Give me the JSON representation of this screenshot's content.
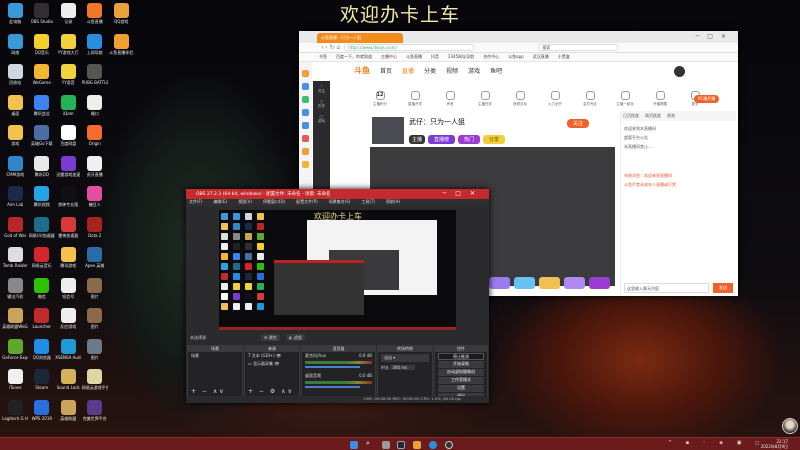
{
  "wallpaper_text": "欢迎办卡上车",
  "desktop_icons": [
    {
      "label": "此电脑",
      "icon": "computer-icon",
      "color": "#3a9ad9"
    },
    {
      "label": "网络",
      "icon": "network-icon",
      "color": "#3a9ad9"
    },
    {
      "label": "回收站",
      "icon": "recycle-bin-icon",
      "color": "#cfd8e0"
    },
    {
      "label": "桌面",
      "icon": "folder-icon",
      "color": "#f2c14e"
    },
    {
      "label": "游戏",
      "icon": "folder-icon",
      "color": "#f2c14e"
    },
    {
      "label": "CMM游戏",
      "icon": "app-icon",
      "color": "#2f86c9"
    },
    {
      "label": "Aim Lab",
      "icon": "aimlab-icon",
      "color": "#1b2a4a"
    },
    {
      "label": "God of War",
      "icon": "godofwar-icon",
      "color": "#b8262a"
    },
    {
      "label": "Tomb Raider",
      "icon": "tombraider-icon",
      "color": "#dddddd"
    },
    {
      "label": "输出汽机",
      "icon": "app-icon",
      "color": "#888888"
    },
    {
      "label": "英雄联盟WeGame",
      "icon": "lol-icon",
      "color": "#c9a55a"
    },
    {
      "label": "GeForce Experience",
      "icon": "nvidia-icon",
      "color": "#5fa82a"
    },
    {
      "label": "iTunes",
      "icon": "itunes-icon",
      "color": "#f0f0f0"
    },
    {
      "label": "Logitech G HUB",
      "icon": "logitech-icon",
      "color": "#222222"
    },
    {
      "label": "OBS Studio",
      "icon": "obs-icon",
      "color": "#302e31"
    },
    {
      "label": "QQ音乐",
      "icon": "qqmusic-icon",
      "color": "#f2cf2a"
    },
    {
      "label": "WeGame",
      "icon": "wegame-icon",
      "color": "#f2b632"
    },
    {
      "label": "腾讯会议",
      "icon": "app-icon",
      "color": "#3c82f0"
    },
    {
      "label": "英雄Go下载",
      "icon": "app-icon",
      "color": "#4a6fa5"
    },
    {
      "label": "腾讯QQ",
      "icon": "qq-icon",
      "color": "#e8e8e8"
    },
    {
      "label": "腾讯视频",
      "icon": "tencent-video-icon",
      "color": "#27a4e6"
    },
    {
      "label": "网易UU加速器",
      "icon": "uu-icon",
      "color": "#1c6e8c"
    },
    {
      "label": "网易云音乐",
      "icon": "netease-music-icon",
      "color": "#d4262c"
    },
    {
      "label": "微信",
      "icon": "wechat-icon",
      "color": "#2dc100"
    },
    {
      "label": "Launcher",
      "icon": "launcher-icon",
      "color": "#c02a2a"
    },
    {
      "label": "QQ浏览器",
      "icon": "qq-browser-icon",
      "color": "#1f8fe6"
    },
    {
      "label": "Steam",
      "icon": "steam-icon",
      "color": "#1b2838"
    },
    {
      "label": "WPS 2019",
      "icon": "wps-icon",
      "color": "#2b6fde"
    },
    {
      "label": "记录",
      "icon": "document-icon",
      "color": "#eeeeee"
    },
    {
      "label": "YY游戏大厅",
      "icon": "yy-icon",
      "color": "#f2d23c"
    },
    {
      "label": "YY语音",
      "icon": "yy-voice-icon",
      "color": "#f2d23c"
    },
    {
      "label": "iQom",
      "icon": "app-icon",
      "color": "#22b456"
    },
    {
      "label": "百度网盘",
      "icon": "baidu-pan-icon",
      "color": "#ffffff"
    },
    {
      "label": "迅雷游戏加速",
      "icon": "game-icon",
      "color": "#7a3bd1"
    },
    {
      "label": "剪映专业版",
      "icon": "capcut-icon",
      "color": "#111111"
    },
    {
      "label": "雷神加速器",
      "icon": "app-icon",
      "color": "#d63a3a"
    },
    {
      "label": "腾讯游戏",
      "icon": "folder-icon",
      "color": "#f2c14e"
    },
    {
      "label": "短信号",
      "icon": "document-icon",
      "color": "#eeeeee"
    },
    {
      "label": "反应游戏",
      "icon": "document-icon",
      "color": "#eeeeee"
    },
    {
      "label": "XSENSA Audio",
      "icon": "audio-icon",
      "color": "#1e9ad6"
    },
    {
      "label": "Sound Lock",
      "icon": "lock-icon",
      "color": "#d4b25a"
    },
    {
      "label": "英雄联盟",
      "icon": "lol-icon",
      "color": "#c9a55a"
    },
    {
      "label": "斗鱼直播",
      "icon": "douyu-icon",
      "color": "#f0772a"
    },
    {
      "label": "上网导航",
      "icon": "ie-icon",
      "color": "#2a8ee0"
    },
    {
      "label": "PUBG BATTLEGROUNDS",
      "icon": "pubg-icon",
      "color": "#555555"
    },
    {
      "label": "端口",
      "icon": "document-icon",
      "color": "#eeeeee"
    },
    {
      "label": "Origin",
      "icon": "origin-icon",
      "color": "#f56c2d"
    },
    {
      "label": "虎牙直播",
      "icon": "huya-icon",
      "color": "#f0f0f0"
    },
    {
      "label": "糖豆人",
      "icon": "fallguys-icon",
      "color": "#e24fa0"
    },
    {
      "label": "Dota 2",
      "icon": "dota-icon",
      "color": "#a8231c"
    },
    {
      "label": "Apex 英雄",
      "icon": "apex-icon",
      "color": "#2a6ca8"
    },
    {
      "label": "图片",
      "icon": "image-icon",
      "color": "#8a6a4a"
    },
    {
      "label": "图片",
      "icon": "image-icon",
      "color": "#8a6a4a"
    },
    {
      "label": "图片",
      "icon": "image-icon",
      "color": "#6a7a8a"
    },
    {
      "label": "网易云游戏平台",
      "icon": "app-icon",
      "color": "#ddd6a0"
    },
    {
      "label": "完美世界平台",
      "icon": "app-icon",
      "color": "#5a3d8a"
    },
    {
      "label": "QQ游戏",
      "icon": "qq-game-icon",
      "color": "#e8a23a"
    },
    {
      "label": "斗鱼直播伴侣",
      "icon": "app-icon",
      "color": "#f0a030"
    }
  ],
  "browser": {
    "tab_label": "斗鱼直播 - 只为一人狙",
    "url": "https://www.douyu.com/",
    "search": "搜索",
    "bookmarks": [
      "书签",
      "百度一下，你就知道",
      "主播中心",
      "斗鱼直播",
      "抖音",
      "2345网址导航",
      "合作中心",
      "斗鱼app",
      "武汉直播",
      "小黑盒"
    ],
    "site_logo": "斗鱼",
    "nav": [
      "首页",
      "直播",
      "分类",
      "视频",
      "游戏",
      "鱼吧"
    ],
    "toolbar": [
      {
        "num": "12",
        "label": "主播积分"
      },
      {
        "num": "",
        "label": "直播开关"
      },
      {
        "num": "",
        "label": "声音"
      },
      {
        "num": "",
        "label": "主播任务"
      },
      {
        "num": "",
        "label": "音频互动"
      },
      {
        "num": "",
        "label": "火力全开"
      },
      {
        "num": "",
        "label": "会员专区"
      },
      {
        "num": "",
        "label": "主播一起玩"
      },
      {
        "num": "",
        "label": "开播提醒"
      },
      {
        "num": "",
        "label": "更多"
      }
    ],
    "pc_button": "PC端开播",
    "room_title": "武仔：只为一人狙",
    "follow": "关注",
    "tags": [
      "主播",
      "直播榜",
      "热门",
      "分享"
    ],
    "chat_tabs": [
      "日活跃度",
      "周活跃度",
      "贵宾"
    ],
    "chat_lines": [
      "欢迎来到本直播间",
      "超管平台公告",
      "本直播间禁止...",
      "系统消息：欢迎来到直播间",
      "斗鱼严禁未成年人直播或打赏"
    ],
    "chat_input": "这里输入聊天内容",
    "send": "发送",
    "sidebar": [
      "关注",
      "历史",
      "游戏"
    ]
  },
  "obs": {
    "title": "OBS 27.2.3 (64-bit, windows) - 配置文件: 未命名 - 场景: 未命名",
    "menu": [
      "文件(F)",
      "编辑(E)",
      "视图(V)",
      "停靠窗口(D)",
      "配置文件(P)",
      "场景集合(S)",
      "工具(T)",
      "帮助(H)"
    ],
    "no_source": "未选择源",
    "properties": "属性",
    "filters": "滤镜",
    "docks": {
      "scenes": "场景",
      "sources": "来源",
      "mixer": "混音器",
      "transitions": "转场特效",
      "controls": "控件"
    },
    "scene_items": [
      "场景"
    ],
    "source_items": [
      "文本 (GDI+)",
      "显示器采集"
    ],
    "mixer": [
      {
        "name": "麦克风/Aux",
        "db": "0.0 dB"
      },
      {
        "name": "桌面音频",
        "db": "0.0 dB"
      }
    ],
    "transition": "淡出",
    "duration_label": "时长",
    "duration": "300 ms",
    "controls": [
      "停止推流",
      "开始录制",
      "启动虚拟摄像机",
      "工作室模式",
      "设置",
      "退出"
    ],
    "status": "LIVE: 00:00:00   REC: 00:00:00   CPU: 1.0%, 60.00 fps"
  },
  "taskbar": {
    "time": "22:17",
    "date": "2022年8月9日"
  }
}
